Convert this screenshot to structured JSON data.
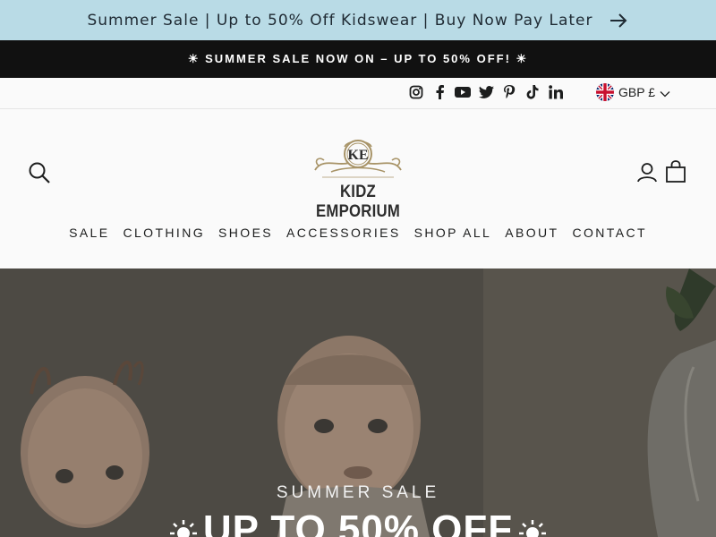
{
  "announcement": {
    "text": "Summer Sale | Up to 50% Off Kidswear | Buy Now Pay Later",
    "arrow_icon": "arrow-right-icon"
  },
  "promo": {
    "text": "☀ SUMMER SALE NOW ON – UP TO 50% OFF! ☀"
  },
  "utility": {
    "socials": [
      "instagram-icon",
      "facebook-icon",
      "youtube-icon",
      "twitter-icon",
      "pinterest-icon",
      "tiktok-icon",
      "linkedin-icon"
    ],
    "currency": {
      "label": "GBP £",
      "flag_icon": "uk-flag-icon"
    }
  },
  "header": {
    "logo_text": "KIDZ EMPORIUM",
    "logo_monogram": "KE",
    "nav": [
      "SALE",
      "CLOTHING",
      "SHOES",
      "ACCESSORIES",
      "SHOP ALL",
      "ABOUT",
      "CONTACT"
    ]
  },
  "hero": {
    "subtitle": "SUMMER SALE",
    "title": "UP TO 50% OFF"
  },
  "colors": {
    "announcement_bg": "#b9dbe6",
    "promo_bg": "#111111",
    "header_bg": "#fafafa"
  }
}
